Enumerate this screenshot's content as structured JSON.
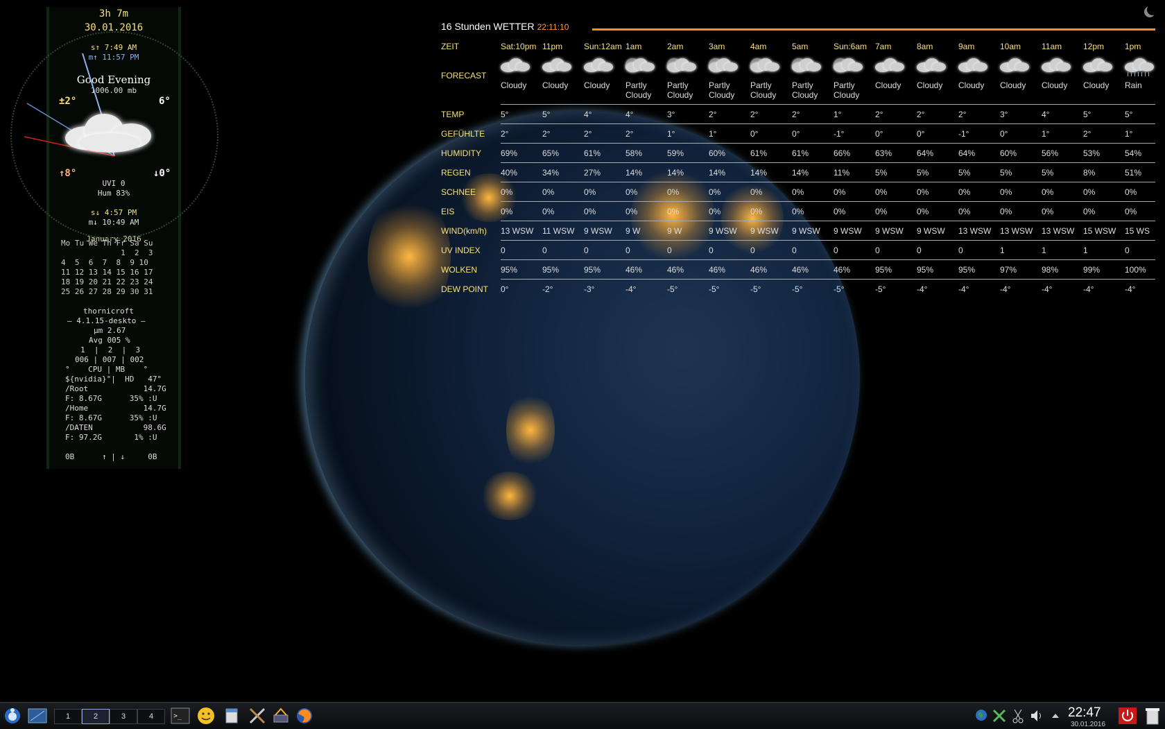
{
  "conky": {
    "uptime": "3h 7m",
    "date": "30.01.2016",
    "sunrise": "s↑ 7:49 AM",
    "moonrise": "m↑ 11:57 PM",
    "greeting": "Good Evening",
    "pressure": "1006.00 mb",
    "temp_now": "±2°",
    "temp_feel": "6°",
    "temp_high": "↑8°",
    "temp_low": "↓0°",
    "uvi": "UVI 0",
    "hum": "Hum 83%",
    "sunset": "s↓ 4:57 PM",
    "moonset": "m↓ 10:49 AM",
    "calendar": {
      "title": "January 2016",
      "header": "Mo Tu We Th Fr Sa Su",
      "rows": [
        "             1  2  3",
        "4  5  6  7  8  9 10",
        "11 12 13 14 15 16 17",
        "18 19 20 21 22 23 24",
        "25 26 27 28 29 30 31"
      ]
    },
    "host": "thornicroft",
    "kernel": "— 4.1.15-deskto —",
    "load": "µm 2.67",
    "avg": "Avg 005 %",
    "cores_head": "1  |  2  |  3",
    "cores_vals": "006 | 007 | 002",
    "temps_head": "°    CPU | MB    °",
    "gpu": "${nvidia}°|  HD   47°",
    "root_label": "/Root            14.7G",
    "root_free": "F: 8.67G      35% :U",
    "home_label": "/Home            14.7G",
    "home_free": "F: 8.67G      35% :U",
    "daten_label": "/DATEN           98.6G",
    "daten_free": "F: 97.2G       1% :U",
    "net": "0B      ↑ | ↓     0B"
  },
  "weather": {
    "title": "16 Stunden WETTER",
    "time": "22:11:10",
    "labels": [
      "ZEIT",
      "FORECAST",
      "TEMP",
      "GEFÜHLTE",
      "HUMIDITY",
      "REGEN",
      "SCHNEE",
      "EIS",
      "WIND(km/h)",
      "UV INDEX",
      "WOLKEN",
      "DEW POINT"
    ],
    "hours": [
      "Sat:10pm",
      "11pm",
      "Sun:12am",
      "1am",
      "2am",
      "3am",
      "4am",
      "5am",
      "Sun:6am",
      "7am",
      "8am",
      "9am",
      "10am",
      "11am",
      "12pm",
      "1pm"
    ],
    "forecast": [
      [
        "Cloudy"
      ],
      [
        "Cloudy"
      ],
      [
        "Cloudy"
      ],
      [
        "Partly",
        "Cloudy"
      ],
      [
        "Partly",
        "Cloudy"
      ],
      [
        "Partly",
        "Cloudy"
      ],
      [
        "Partly",
        "Cloudy"
      ],
      [
        "Partly",
        "Cloudy"
      ],
      [
        "Partly",
        "Cloudy"
      ],
      [
        "Cloudy"
      ],
      [
        "Cloudy"
      ],
      [
        "Cloudy"
      ],
      [
        "Cloudy"
      ],
      [
        "Cloudy"
      ],
      [
        "Cloudy"
      ],
      [
        "Rain"
      ]
    ],
    "icons": [
      "cloud-icon",
      "cloud-icon",
      "cloud-icon",
      "moon-cloud-icon",
      "moon-cloud-icon",
      "moon-cloud-icon",
      "moon-cloud-icon",
      "moon-cloud-icon",
      "moon-cloud-icon",
      "cloud-icon",
      "cloud-icon",
      "cloud-icon",
      "cloud-icon",
      "cloud-icon",
      "cloud-icon",
      "rain-icon"
    ],
    "rows": [
      [
        "5°",
        "5°",
        "4°",
        "4°",
        "3°",
        "2°",
        "2°",
        "2°",
        "1°",
        "2°",
        "2°",
        "2°",
        "3°",
        "4°",
        "5°",
        "5°"
      ],
      [
        "2°",
        "2°",
        "2°",
        "2°",
        "1°",
        "1°",
        "0°",
        "0°",
        "-1°",
        "0°",
        "0°",
        "-1°",
        "0°",
        "1°",
        "2°",
        "1°"
      ],
      [
        "69%",
        "65%",
        "61%",
        "58%",
        "59%",
        "60%",
        "61%",
        "61%",
        "66%",
        "63%",
        "64%",
        "64%",
        "60%",
        "56%",
        "53%",
        "54%"
      ],
      [
        "40%",
        "34%",
        "27%",
        "14%",
        "14%",
        "14%",
        "14%",
        "14%",
        "11%",
        "5%",
        "5%",
        "5%",
        "5%",
        "5%",
        "8%",
        "51%"
      ],
      [
        "0%",
        "0%",
        "0%",
        "0%",
        "0%",
        "0%",
        "0%",
        "0%",
        "0%",
        "0%",
        "0%",
        "0%",
        "0%",
        "0%",
        "0%",
        "0%"
      ],
      [
        "0%",
        "0%",
        "0%",
        "0%",
        "0%",
        "0%",
        "0%",
        "0%",
        "0%",
        "0%",
        "0%",
        "0%",
        "0%",
        "0%",
        "0%",
        "0%"
      ],
      [
        "13 WSW",
        "11 WSW",
        "9 WSW",
        "9 W",
        "9 W",
        "9 WSW",
        "9 WSW",
        "9 WSW",
        "9 WSW",
        "9 WSW",
        "9 WSW",
        "13 WSW",
        "13 WSW",
        "13 WSW",
        "15 WSW",
        "15 WS"
      ],
      [
        "0",
        "0",
        "0",
        "0",
        "0",
        "0",
        "0",
        "0",
        "0",
        "0",
        "0",
        "0",
        "1",
        "1",
        "1",
        "0"
      ],
      [
        "95%",
        "95%",
        "95%",
        "46%",
        "46%",
        "46%",
        "46%",
        "46%",
        "46%",
        "95%",
        "95%",
        "95%",
        "97%",
        "98%",
        "99%",
        "100%"
      ],
      [
        "0°",
        "-2°",
        "-3°",
        "-4°",
        "-5°",
        "-5°",
        "-5°",
        "-5°",
        "-5°",
        "-5°",
        "-4°",
        "-4°",
        "-4°",
        "-4°",
        "-4°",
        "-4°"
      ]
    ]
  },
  "taskbar": {
    "desktops": [
      "1",
      "2",
      "3",
      "4"
    ],
    "active_desktop": "2",
    "launchers": [
      "terminal-icon",
      "smiley-icon",
      "notes-icon",
      "tools-icon",
      "network-manager-icon",
      "firefox-icon"
    ],
    "tray": [
      "globe-icon",
      "connection-icon",
      "scissors-icon",
      "volume-icon",
      "tray-arrow-icon"
    ],
    "clock": "22:47",
    "date": "30.01.2016"
  }
}
